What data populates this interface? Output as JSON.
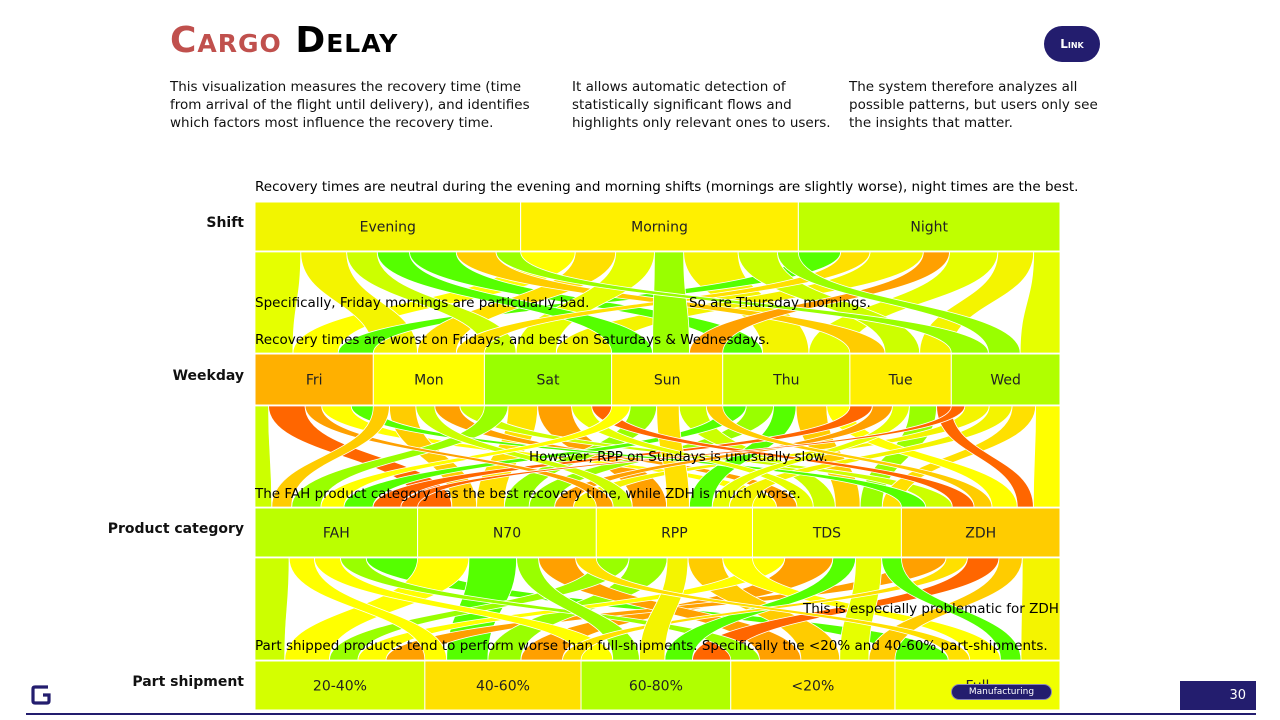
{
  "title": {
    "part1": "Cargo",
    "part2": "Delay"
  },
  "link_label": "Link",
  "intro": [
    "This visualization measures the recovery time (time from arrival of the flight until delivery), and identifies which factors most influence the recovery time.",
    "It allows automatic detection of statistically significant flows and highlights only relevant ones to users.",
    "The system therefore analyzes all possible patterns, but users only see the insights that matter."
  ],
  "dimensions": [
    {
      "label": "Shift",
      "categories": [
        {
          "name": "Evening",
          "share": 0.33,
          "color": "#f2f500"
        },
        {
          "name": "Morning",
          "share": 0.345,
          "color": "#fff000"
        },
        {
          "name": "Night",
          "share": 0.325,
          "color": "#bfff00"
        }
      ]
    },
    {
      "label": "Weekday",
      "categories": [
        {
          "name": "Fri",
          "share": 0.147,
          "color": "#ffb000"
        },
        {
          "name": "Mon",
          "share": 0.138,
          "color": "#ffff00"
        },
        {
          "name": "Sat",
          "share": 0.158,
          "color": "#99ff00"
        },
        {
          "name": "Sun",
          "share": 0.138,
          "color": "#ffee00"
        },
        {
          "name": "Thu",
          "share": 0.158,
          "color": "#ccff00"
        },
        {
          "name": "Tue",
          "share": 0.126,
          "color": "#ffee00"
        },
        {
          "name": "Wed",
          "share": 0.135,
          "color": "#b0ff00"
        }
      ]
    },
    {
      "label": "Product category",
      "categories": [
        {
          "name": "FAH",
          "share": 0.202,
          "color": "#bbff00"
        },
        {
          "name": "N70",
          "share": 0.222,
          "color": "#ddff00"
        },
        {
          "name": "RPP",
          "share": 0.194,
          "color": "#ffff00"
        },
        {
          "name": "TDS",
          "share": 0.185,
          "color": "#eeff00"
        },
        {
          "name": "ZDH",
          "share": 0.197,
          "color": "#ffcc00"
        }
      ]
    },
    {
      "label": "Part shipment",
      "categories": [
        {
          "name": "20-40%",
          "share": 0.211,
          "color": "#d4ff00"
        },
        {
          "name": "40-60%",
          "share": 0.194,
          "color": "#ffe000"
        },
        {
          "name": "60-80%",
          "share": 0.186,
          "color": "#b0ff00"
        },
        {
          "name": "<20%",
          "share": 0.204,
          "color": "#ffea00"
        },
        {
          "name": "Full",
          "share": 0.205,
          "color": "#f0ff00"
        }
      ]
    }
  ],
  "flow_palette": [
    "#ffff00",
    "#e6ff00",
    "#ccff00",
    "#99ff00",
    "#55ff00",
    "#ffe000",
    "#ffcc00",
    "#ffa000",
    "#ff6600",
    "#f4f400"
  ],
  "notes": {
    "shift": "Recovery times are neutral during the evening and morning shifts (mornings are slightly worse), night times are the best.",
    "friday_morning": "Specifically, Friday mornings are particularly bad.",
    "thursday_morning": "So are Thursday mornings.",
    "weekday": "Recovery times are worst on Fridays, and best on Saturdays & Wednesdays.",
    "rpp_sunday": "However, RPP on Sundays is unusually slow.",
    "product": "The FAH product category has the best recovery time, while ZDH is much worse.",
    "zdh": "This is especially problematic for ZDH",
    "part": "Part shipped products tend to perform worse than full-shipments. Specifically the <20% and 40-60% part-shipments."
  },
  "footer": {
    "badge": "Manufacturing",
    "page_number": "30",
    "brand_color": "#231d6e"
  }
}
